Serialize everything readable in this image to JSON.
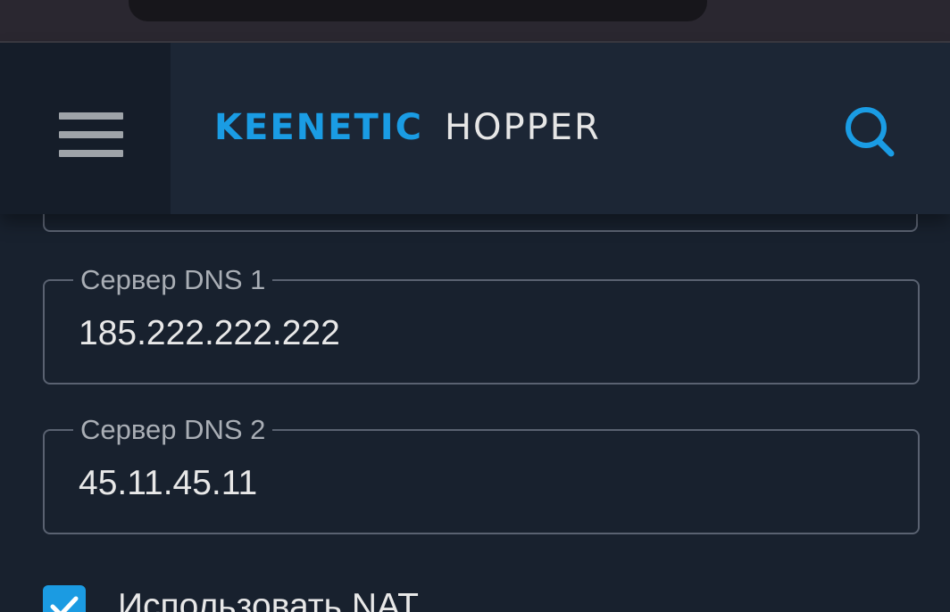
{
  "header": {
    "brand": "KEENETIC",
    "product": "HOPPER",
    "menu_icon": "hamburger-menu-icon",
    "search_icon": "search-icon"
  },
  "form": {
    "dns1": {
      "label": "Сервер DNS 1",
      "value": "185.222.222.222"
    },
    "dns2": {
      "label": "Сервер DNS 2",
      "value": "45.11.45.11"
    },
    "nat": {
      "label": "Использовать NAT",
      "checked": true
    }
  },
  "colors": {
    "accent": "#1a9ce4",
    "background": "#18212e",
    "header": "#1c2635",
    "border": "#5a6271"
  }
}
